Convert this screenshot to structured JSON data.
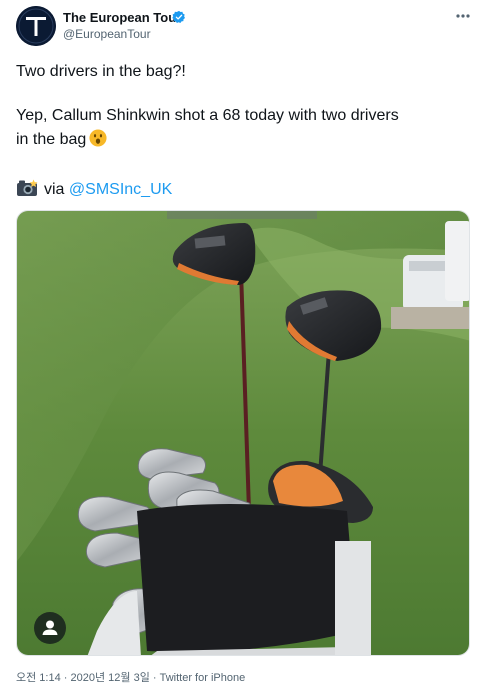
{
  "author": {
    "display_name": "The European Tour",
    "handle": "@EuropeanTour",
    "verified": true,
    "avatar_icon": "european-tour-logo"
  },
  "tweet": {
    "line1": "Two drivers in the bag?!",
    "line2": "Yep, Callum Shinkwin shot a 68 today with two drivers",
    "line3": "in the bag",
    "emoji_icon": "astonished-face-emoji",
    "via_icon": "camera-flash-emoji",
    "via_label": "via",
    "mention": "@SMSInc_UK"
  },
  "media": {
    "type": "photo",
    "tag_icon": "person-icon"
  },
  "meta": {
    "time": "오전 1:14",
    "separator": "·",
    "date": "2020년 12월 3일",
    "source": "Twitter for iPhone"
  },
  "colors": {
    "link": "#1d9bf0",
    "secondary_text": "#536471",
    "verified": "#1d9bf0"
  }
}
